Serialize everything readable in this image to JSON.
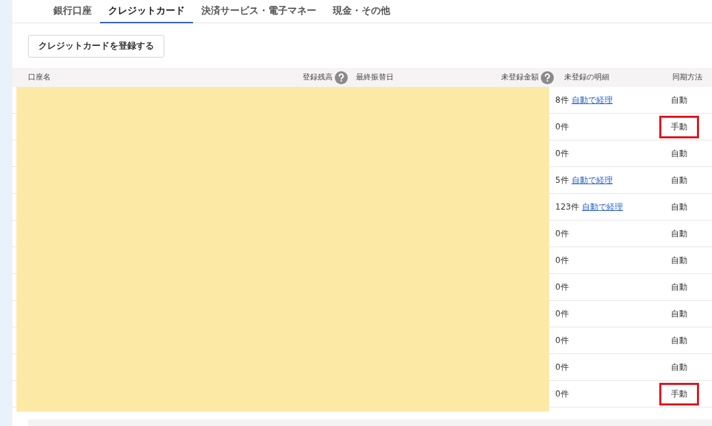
{
  "tabs": [
    {
      "label": "銀行口座",
      "selected": false
    },
    {
      "label": "クレジットカード",
      "selected": true
    },
    {
      "label": "決済サービス・電子マネー",
      "selected": false
    },
    {
      "label": "現金・その他",
      "selected": false
    }
  ],
  "register_button": "クレジットカードを登録する",
  "table": {
    "columns": [
      {
        "label": "口座名"
      },
      {
        "label": "登録残高",
        "help": true
      },
      {
        "label": "最終振替日"
      },
      {
        "label": "未登録金額",
        "help": true
      },
      {
        "label": "未登録の明細"
      },
      {
        "label": "同期方法"
      }
    ],
    "rows": [
      {
        "count": "8件",
        "link": "自動で経理",
        "sync": "自動",
        "highlighted": false
      },
      {
        "count": "0件",
        "sync": "手動",
        "highlighted": true
      },
      {
        "count": "0件",
        "sync": "自動",
        "highlighted": false
      },
      {
        "count": "5件",
        "link": "自動で経理",
        "sync": "自動",
        "highlighted": false
      },
      {
        "count": "123件",
        "link": "自動で経理",
        "sync": "自動",
        "highlighted": false
      },
      {
        "count": "0件",
        "sync": "自動",
        "highlighted": false
      },
      {
        "count": "0件",
        "sync": "自動",
        "highlighted": false
      },
      {
        "count": "0件",
        "sync": "自動",
        "highlighted": false
      },
      {
        "count": "0件",
        "sync": "自動",
        "highlighted": false
      },
      {
        "count": "0件",
        "sync": "自動",
        "highlighted": false
      },
      {
        "count": "0件",
        "sync": "自動",
        "highlighted": false
      },
      {
        "count": "0件",
        "sync": "手動",
        "highlighted": true
      }
    ]
  }
}
